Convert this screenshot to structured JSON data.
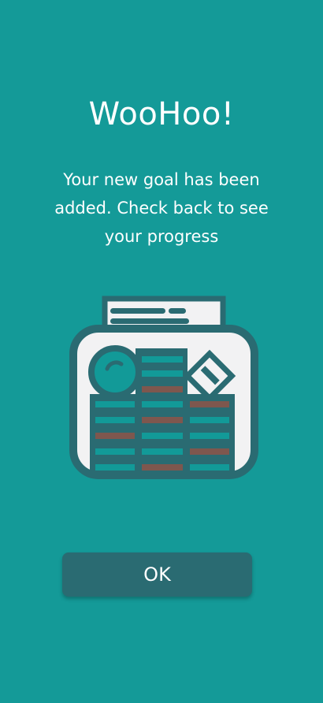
{
  "dialog": {
    "title": "WooHoo!",
    "message": "Your new goal has been added. Check back to see your progress",
    "ok_label": "OK"
  },
  "illustration": {
    "icon": "money-jar-icon",
    "colors": {
      "outline": "#2a6b72",
      "jar_fill": "#f2f2f3",
      "coin_teal": "#129a98",
      "coin_brown": "#7e574e"
    }
  },
  "colors": {
    "background": "#149a98",
    "button": "#2a6b72",
    "text": "#ffffff"
  }
}
